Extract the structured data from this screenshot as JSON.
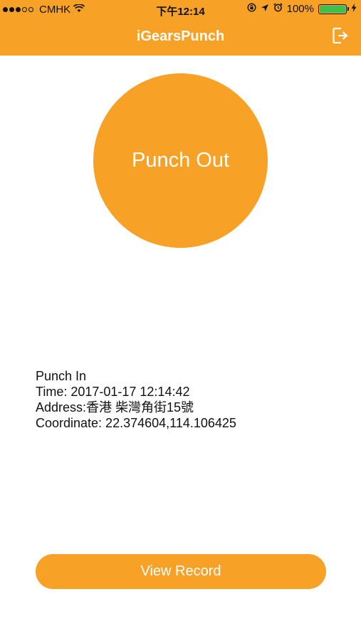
{
  "status_bar": {
    "carrier": "CMHK",
    "time": "下午12:14",
    "battery_percent": "100%",
    "battery_level": 1.0,
    "icons": [
      "signal-dots-icon",
      "wifi-icon",
      "screen-lock-icon",
      "location-arrow-icon",
      "alarm-icon",
      "battery-icon",
      "charging-icon"
    ]
  },
  "nav": {
    "title": "iGearsPunch",
    "logout_icon": "logout-icon"
  },
  "punch_button": {
    "label": "Punch Out"
  },
  "punch_info": {
    "heading": "Punch In",
    "time": "Time: 2017-01-17 12:14:42",
    "address": "Address:香港 柴灣角街15號",
    "coordinate": "Coordinate: 22.374604,114.106425"
  },
  "view_record_button": {
    "label": "View Record"
  },
  "colors": {
    "accent": "#f7a127",
    "battery_green": "#3ec14a"
  }
}
